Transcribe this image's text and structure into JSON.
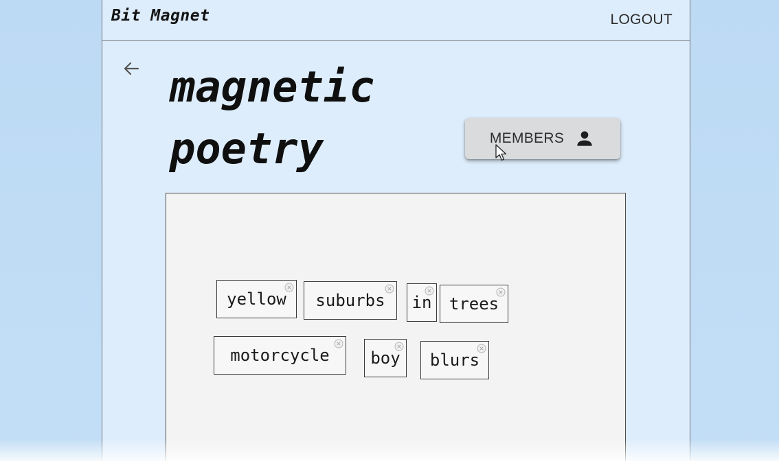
{
  "header": {
    "brand": "Bit Magnet",
    "logout_label": "LOGOUT"
  },
  "page": {
    "title": "magnetic poetry",
    "back_icon": "arrow-left-icon"
  },
  "members_button": {
    "label": "MEMBERS",
    "icon": "person-icon"
  },
  "board": {
    "words": [
      {
        "text": "yellow"
      },
      {
        "text": "suburbs"
      },
      {
        "text": "in"
      },
      {
        "text": "trees"
      },
      {
        "text": "motorcycle"
      },
      {
        "text": "boy"
      },
      {
        "text": "blurs"
      }
    ]
  },
  "colors": {
    "app_background": "#deedfb",
    "outer_background": "#bfdcf5",
    "board_background": "#f3f3f3",
    "button_background": "#dadbdd"
  }
}
